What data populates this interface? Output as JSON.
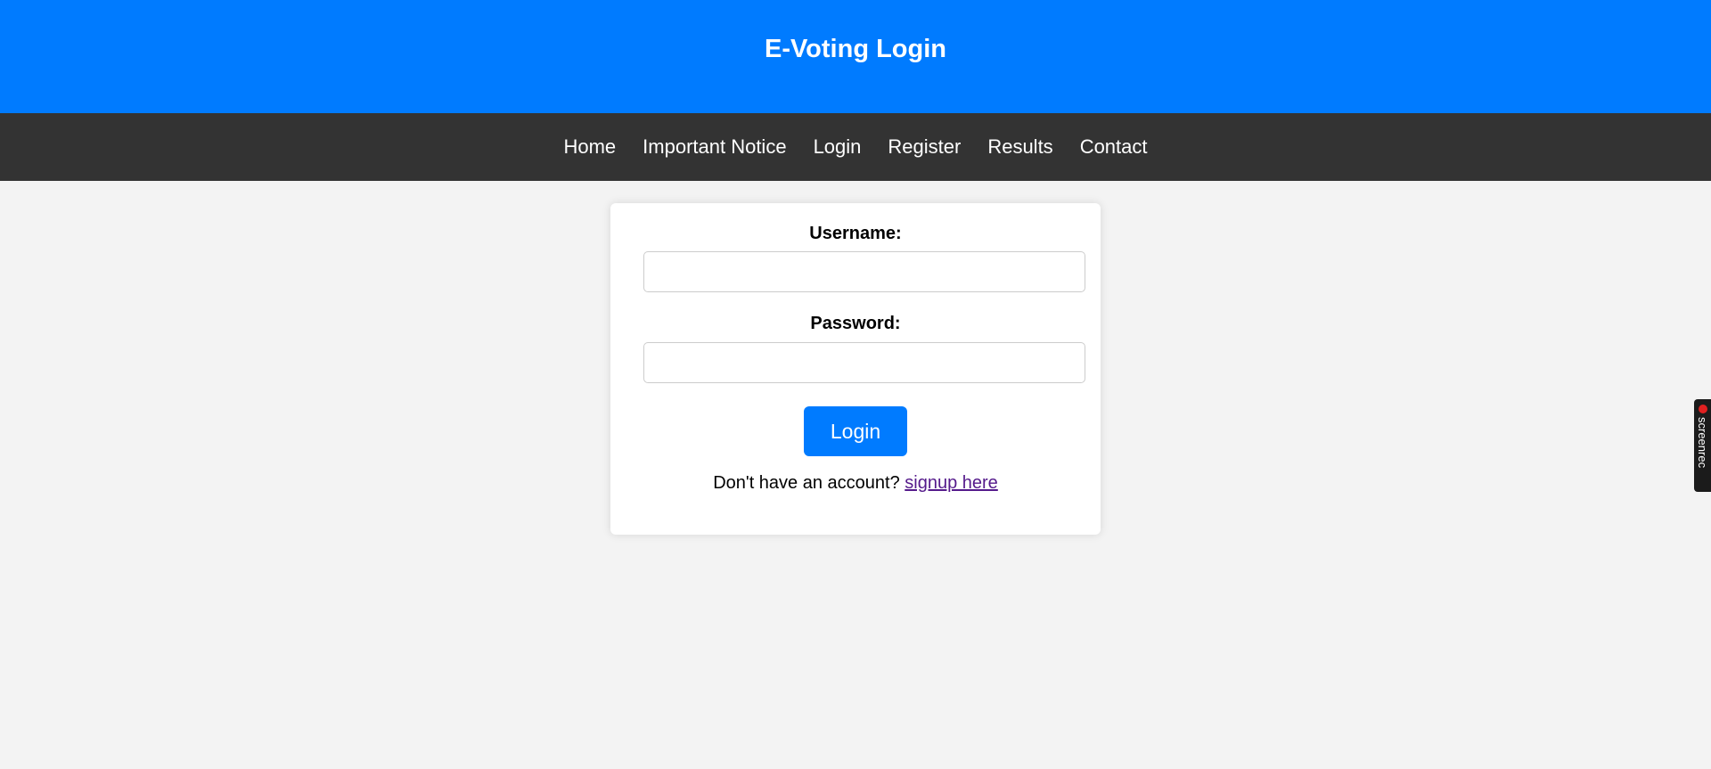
{
  "header": {
    "title": "E-Voting Login"
  },
  "nav": {
    "items": [
      {
        "label": "Home"
      },
      {
        "label": "Important Notice"
      },
      {
        "label": "Login"
      },
      {
        "label": "Register"
      },
      {
        "label": "Results"
      },
      {
        "label": "Contact"
      }
    ]
  },
  "form": {
    "username_label": "Username:",
    "username_value": "",
    "password_label": "Password:",
    "password_value": "",
    "submit_label": "Login",
    "signup_prompt": "Don't have an account?",
    "signup_link": "signup here"
  },
  "overlay": {
    "screenrec_label": "screenrec"
  },
  "colors": {
    "header_bg": "#007bff",
    "nav_bg": "#333333",
    "page_bg": "#f3f3f3",
    "button_bg": "#007bff",
    "link_visited": "#551a8b"
  }
}
